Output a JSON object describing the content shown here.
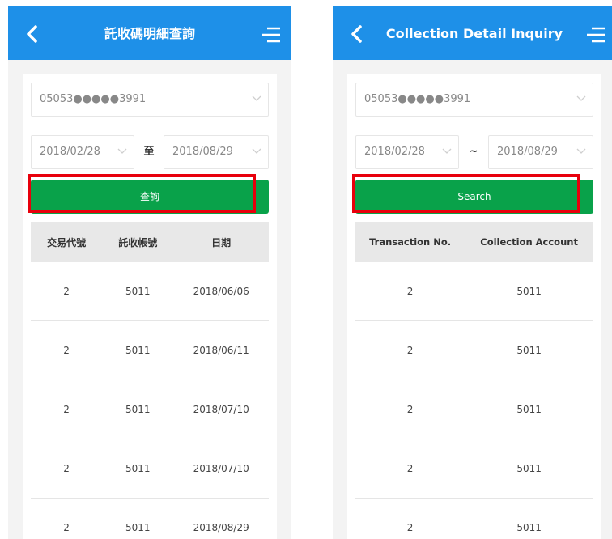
{
  "left": {
    "header": {
      "title": "託收碼明細查詢"
    },
    "account": {
      "value": "05053●●●●●3991"
    },
    "date_range": {
      "start": "2018/02/28",
      "separator": "至",
      "end": "2018/08/29"
    },
    "search": {
      "label": "查詢"
    },
    "table": {
      "columns": [
        "交易代號",
        "託收帳號",
        "日期"
      ],
      "rows": [
        [
          "2",
          "5011",
          "2018/06/06"
        ],
        [
          "2",
          "5011",
          "2018/06/11"
        ],
        [
          "2",
          "5011",
          "2018/07/10"
        ],
        [
          "2",
          "5011",
          "2018/07/10"
        ],
        [
          "2",
          "5011",
          "2018/08/29"
        ]
      ]
    }
  },
  "right": {
    "header": {
      "title": "Collection Detail Inquiry"
    },
    "account": {
      "value": "05053●●●●●3991"
    },
    "date_range": {
      "start": "2018/02/28",
      "separator": "~",
      "end": "2018/08/29"
    },
    "search": {
      "label": "Search"
    },
    "table": {
      "columns": [
        "Transaction No.",
        "Collection Account"
      ],
      "rows": [
        [
          "2",
          "5011"
        ],
        [
          "2",
          "5011"
        ],
        [
          "2",
          "5011"
        ],
        [
          "2",
          "5011"
        ],
        [
          "2",
          "5011"
        ]
      ]
    }
  },
  "colors": {
    "header_blue": "#1e90e8",
    "button_green": "#09a24a",
    "highlight_red": "#e8000c"
  },
  "icons": [
    "back-arrow-icon",
    "menu-icon",
    "chevron-down-icon"
  ]
}
